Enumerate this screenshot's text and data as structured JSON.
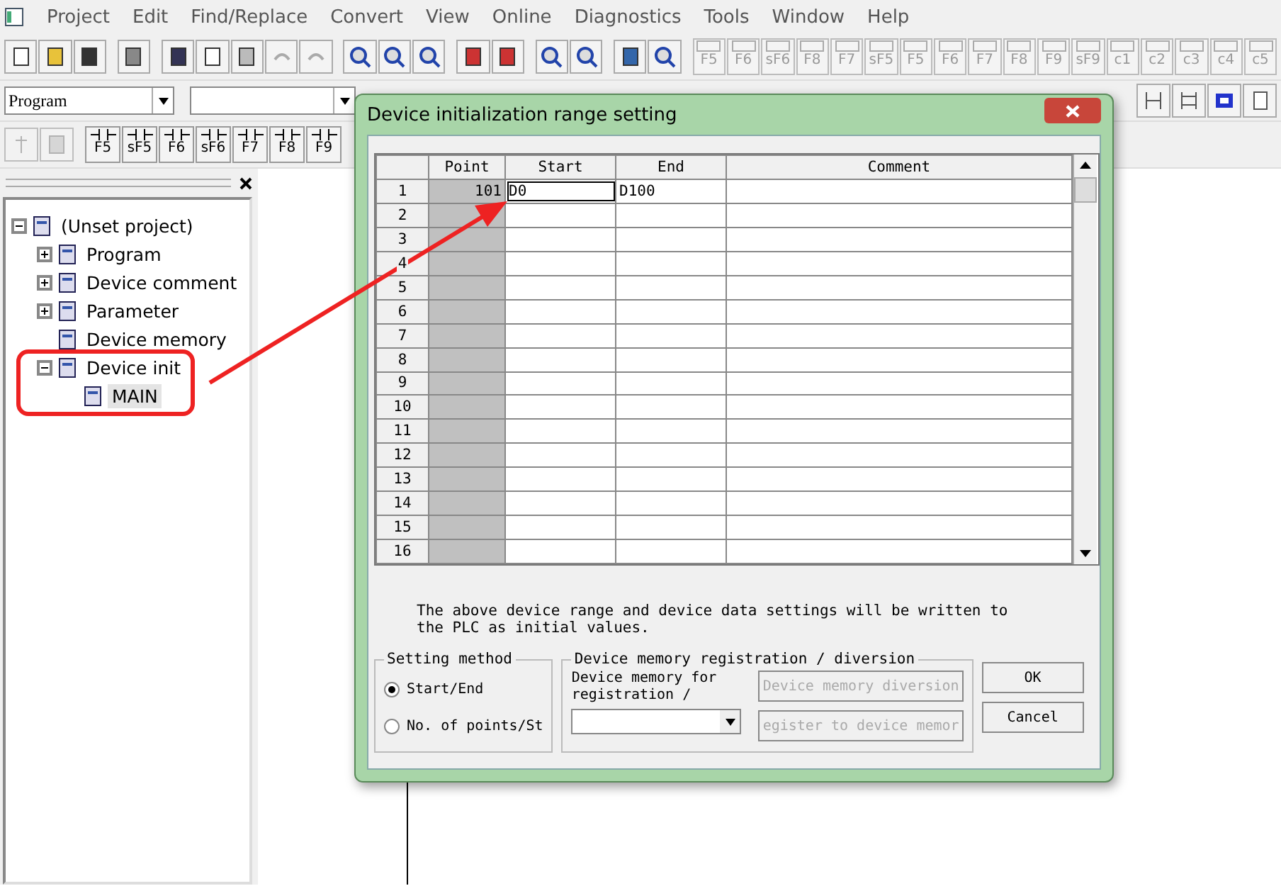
{
  "menu": [
    "Project",
    "Edit",
    "Find/Replace",
    "Convert",
    "View",
    "Online",
    "Diagnostics",
    "Tools",
    "Window",
    "Help"
  ],
  "toolbar_keys": [
    "F5",
    "F6",
    "sF6",
    "F8",
    "F7",
    "sF5",
    "F5",
    "F6",
    "F7",
    "F8",
    "F9",
    "sF9",
    "c1",
    "c2",
    "c3",
    "c4",
    "c5"
  ],
  "mode_combo": {
    "value": "Program"
  },
  "ladder_keys": [
    "F5",
    "sF5",
    "F6",
    "sF6",
    "F7",
    "F8",
    "F9"
  ],
  "tree": [
    {
      "label": "(Unset project)",
      "expanded": true,
      "selected": false,
      "children": [
        {
          "label": "Program",
          "expanded": false,
          "selected": false
        },
        {
          "label": "Device comment",
          "expanded": false,
          "selected": false
        },
        {
          "label": "Parameter",
          "expanded": false,
          "selected": false
        },
        {
          "label": "Device memory",
          "selected": false
        },
        {
          "label": "Device init",
          "expanded": true,
          "selected": false,
          "children": [
            {
              "label": "MAIN",
              "selected": true
            }
          ]
        }
      ]
    }
  ],
  "dialog": {
    "title": "Device initialization range setting",
    "columns": [
      "Point",
      "Start",
      "End",
      "Comment"
    ],
    "rows": [
      {
        "number": "1",
        "point": "101",
        "start": "D0",
        "end": "D100"
      },
      {
        "number": "2"
      },
      {
        "number": "3"
      },
      {
        "number": "4"
      },
      {
        "number": "5"
      },
      {
        "number": "6"
      },
      {
        "number": "7"
      },
      {
        "number": "8"
      },
      {
        "number": "9"
      },
      {
        "number": "10"
      },
      {
        "number": "11"
      },
      {
        "number": "12"
      },
      {
        "number": "13"
      },
      {
        "number": "14"
      },
      {
        "number": "15"
      },
      {
        "number": "16"
      }
    ],
    "description": "The above device range and device data settings will be written to the PLC as initial values.",
    "setting_method": {
      "title": "Setting method",
      "options": [
        {
          "label": "Start/End",
          "selected": true
        },
        {
          "label": "No. of points/St",
          "selected": false
        }
      ]
    },
    "registration": {
      "title": "Device memory registration / diversion",
      "label": "Device memory for registration /",
      "buttons": [
        {
          "label": "Device memory diversion",
          "disabled": true
        },
        {
          "label": "egister to device memor",
          "disabled": true
        }
      ]
    },
    "buttons": [
      "OK",
      "Cancel"
    ]
  }
}
